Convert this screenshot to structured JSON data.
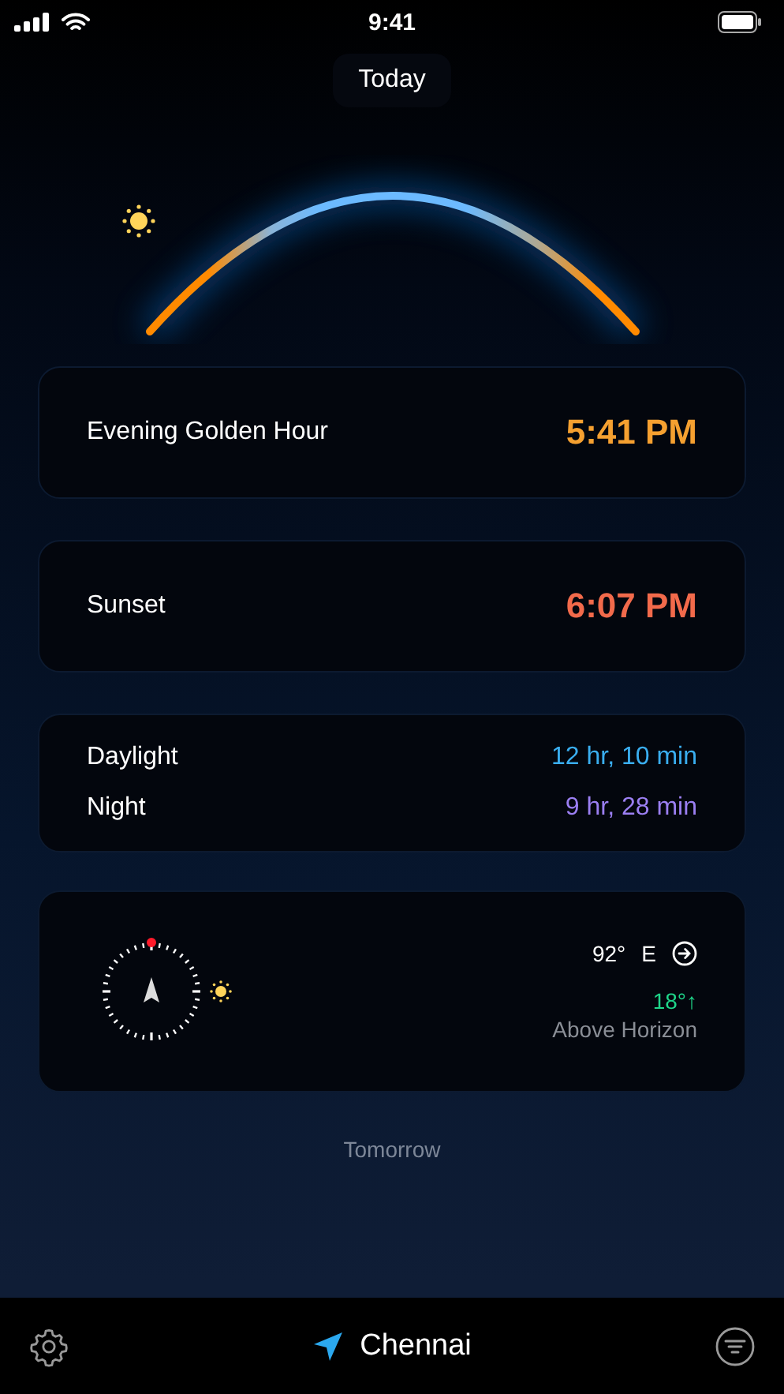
{
  "status_bar": {
    "time": "9:41"
  },
  "day_button": "Today",
  "events": [
    {
      "label": "Evening Golden Hour",
      "time": "5:41 PM",
      "color": "#f5a030"
    },
    {
      "label": "Sunset",
      "time": "6:07 PM",
      "color": "#f26a4b"
    }
  ],
  "durations": [
    {
      "label": "Daylight",
      "value": "12 hr, 10 min",
      "color": "#3aaef0"
    },
    {
      "label": "Night",
      "value": "9 hr, 28 min",
      "color": "#9b7ff2"
    }
  ],
  "sun_position": {
    "azimuth": "92°",
    "direction": "E",
    "altitude": "18°↑",
    "altitude_label": "Above Horizon"
  },
  "next_day_link": "Tomorrow",
  "location": "Chennai"
}
